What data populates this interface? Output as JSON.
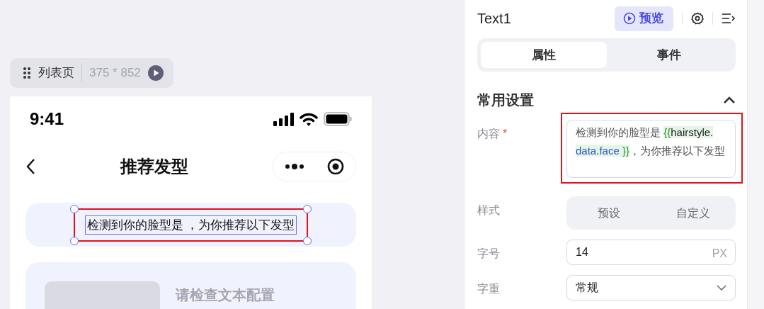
{
  "canvas_toolbar": {
    "page_name": "列表页",
    "size": "375 * 852"
  },
  "phone": {
    "time": "9:41",
    "title": "推荐发型",
    "text_block": {
      "text": "检测到你的脸型是 ，为你推荐以下发型",
      "selected": true
    },
    "card": {
      "placeholder_text": "请检查文本配置"
    }
  },
  "panel": {
    "title": "Text1",
    "preview_button": "预览",
    "tabs": [
      {
        "label": "属性",
        "selected": true
      },
      {
        "label": "事件",
        "selected": false
      }
    ],
    "section": {
      "title": "常用设置",
      "expanded": true
    },
    "fields": [
      {
        "kind": "rich",
        "label": "内容",
        "required_mark": "*",
        "highlighted": true,
        "segments": [
          {
            "kind": "text",
            "text": "检测到你的脸型是 "
          },
          {
            "kind": "brace",
            "text": "{{"
          },
          {
            "kind": "root",
            "text": "hairstyle"
          },
          {
            "kind": "dot",
            "text": "."
          },
          {
            "kind": "prop",
            "text": "data"
          },
          {
            "kind": "dot",
            "text": "."
          },
          {
            "kind": "prop",
            "text": "face"
          },
          {
            "kind": "brace",
            "text": " }}"
          },
          {
            "kind": "text",
            "text": "，为你推荐以下发型"
          }
        ]
      },
      {
        "kind": "segmented",
        "label": "样式",
        "options": [
          {
            "label": "预设",
            "selected": false
          },
          {
            "label": "自定义",
            "selected": false
          }
        ]
      },
      {
        "kind": "number",
        "label": "字号",
        "value": "14",
        "unit": "PX"
      },
      {
        "kind": "select",
        "label": "字重",
        "value": "常规"
      }
    ]
  }
}
